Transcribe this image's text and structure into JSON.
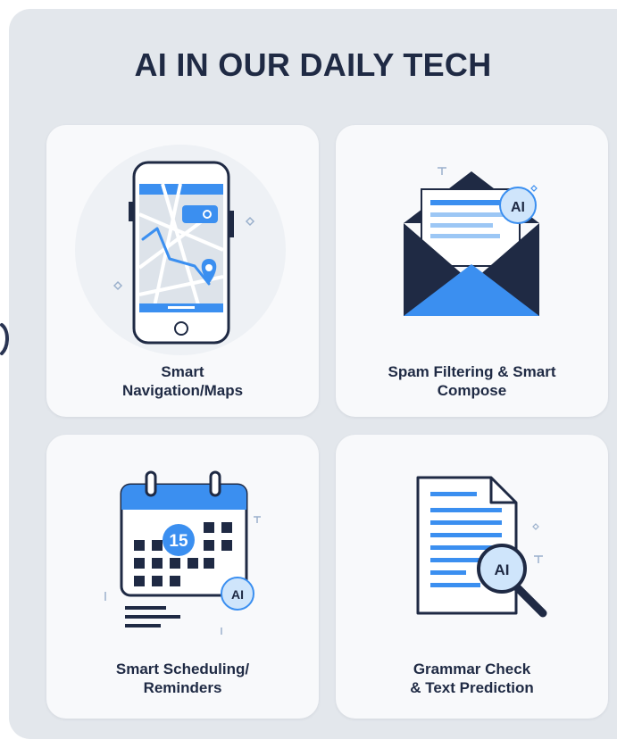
{
  "title": "AI IN OUR DAILY TECH",
  "cards": [
    {
      "label_line1": "Smart",
      "label_line2": "Navigation/Maps",
      "icon": "smartphone-map-icon"
    },
    {
      "label_line1": "Spam Filtering & Smart",
      "label_line2": "Compose",
      "icon": "email-envelope-icon"
    },
    {
      "label_line1": "Smart Scheduling/",
      "label_line2": "Reminders",
      "icon": "calendar-icon"
    },
    {
      "label_line1": "Grammar Check",
      "label_line2": "& Text Prediction",
      "icon": "document-magnifier-icon"
    }
  ],
  "badges": {
    "ai": "AI",
    "calendar_date": "15"
  },
  "colors": {
    "panel": "#e3e7ec",
    "card": "#f8f9fb",
    "navy": "#1f2a44",
    "blue": "#3b8ff0",
    "light_blue": "#cfe5fb"
  }
}
